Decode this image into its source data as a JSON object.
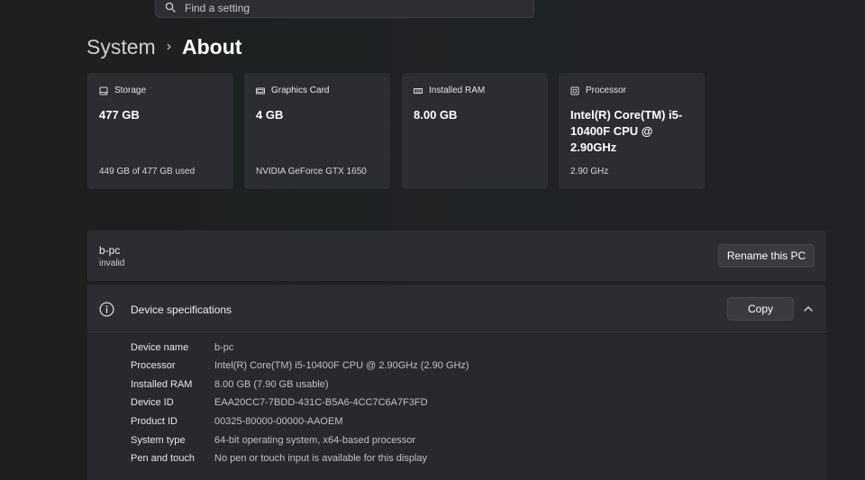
{
  "search": {
    "placeholder": "Find a setting"
  },
  "breadcrumb": {
    "parent": "System",
    "separator": "›",
    "current": "About"
  },
  "cards": [
    {
      "icon": "storage-icon",
      "label": "Storage",
      "value": "477 GB",
      "sub": "449 GB of 477 GB used"
    },
    {
      "icon": "graphics-card-icon",
      "label": "Graphics Card",
      "value": "4 GB",
      "sub": "NVIDIA GeForce GTX 1650"
    },
    {
      "icon": "ram-icon",
      "label": "Installed RAM",
      "value": "8.00 GB",
      "sub": ""
    },
    {
      "icon": "processor-icon",
      "label": "Processor",
      "value": "Intel(R) Core(TM) i5-10400F CPU @ 2.90GHz",
      "sub": "2.90 GHz"
    }
  ],
  "pc": {
    "name": "b-pc",
    "description": "invalid",
    "rename_label": "Rename this PC"
  },
  "specs": {
    "title": "Device specifications",
    "copy_label": "Copy",
    "rows": [
      {
        "label": "Device name",
        "value": "b-pc"
      },
      {
        "label": "Processor",
        "value": "Intel(R) Core(TM) i5-10400F CPU @ 2.90GHz (2.90 GHz)"
      },
      {
        "label": "Installed RAM",
        "value": "8.00 GB (7.90 GB usable)"
      },
      {
        "label": "Device ID",
        "value": "EAA20CC7-7BDD-431C-B5A6-4CC7C6A7F3FD"
      },
      {
        "label": "Product ID",
        "value": "00325-80000-00000-AAOEM"
      },
      {
        "label": "System type",
        "value": "64-bit operating system, x64-based processor"
      },
      {
        "label": "Pen and touch",
        "value": "No pen or touch input is available for this display"
      }
    ]
  }
}
